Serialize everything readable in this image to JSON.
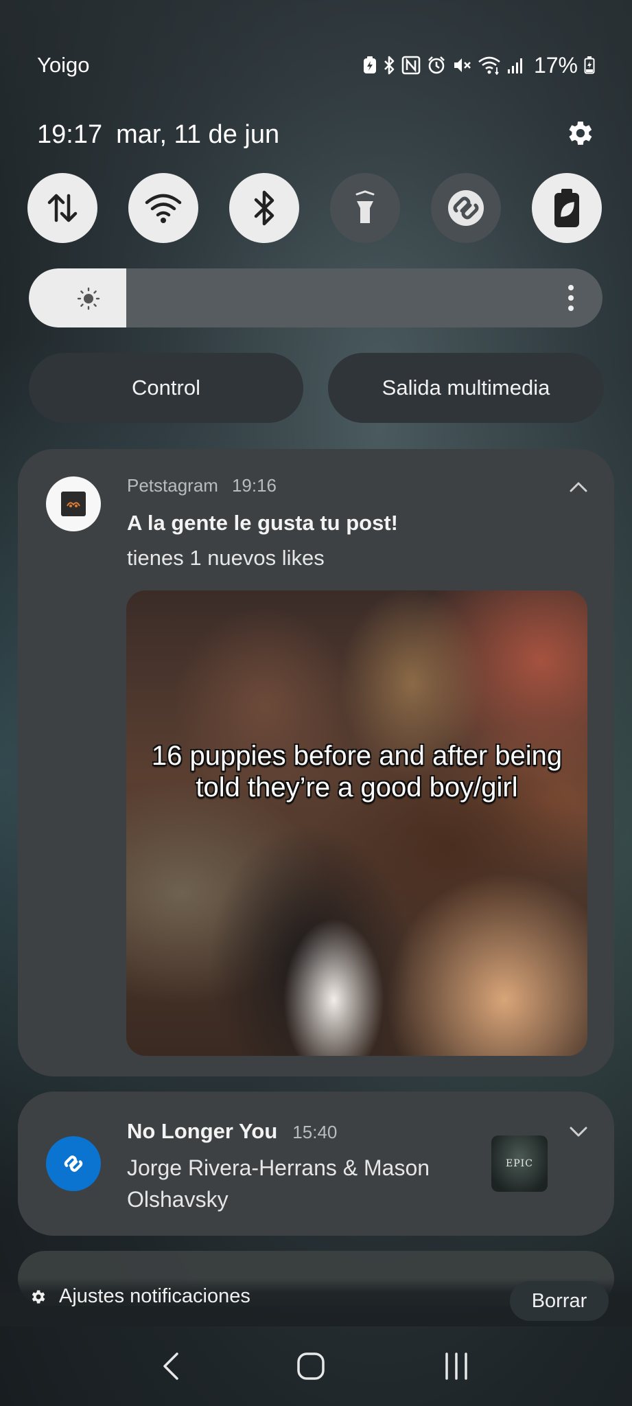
{
  "status_bar": {
    "carrier": "Yoigo",
    "battery_percent": "17%",
    "icons": [
      "battery-saver-icon",
      "bluetooth-icon",
      "nfc-icon",
      "alarm-icon",
      "mute-icon",
      "wifi-icon",
      "signal-icon",
      "battery-charging-icon"
    ]
  },
  "header": {
    "time": "19:17",
    "date": "mar, 11 de jun"
  },
  "quick_tiles": [
    {
      "name": "mobile-data",
      "icon": "data-arrows-icon",
      "active": true
    },
    {
      "name": "wifi",
      "icon": "wifi-icon",
      "active": true
    },
    {
      "name": "bluetooth",
      "icon": "bluetooth-icon",
      "active": true
    },
    {
      "name": "flashlight",
      "icon": "flashlight-icon",
      "active": false
    },
    {
      "name": "shazam",
      "icon": "shazam-icon",
      "active": false
    },
    {
      "name": "power-saving",
      "icon": "eco-battery-icon",
      "active": true
    }
  ],
  "brightness": {
    "level": 0.17
  },
  "buttons": {
    "control": "Control",
    "media_output": "Salida multimedia"
  },
  "notifications": [
    {
      "app": "Petstagram",
      "time": "19:16",
      "title": "A la gente le gusta tu post!",
      "text": "tienes 1 nuevos likes",
      "image_caption": "16 puppies before and after being told they’re a good boy/girl"
    },
    {
      "app": "Shazam",
      "title": "No Longer You",
      "time": "15:40",
      "text": "Jorge Rivera-Herrans & Mason Olshavsky",
      "album_label": "EPIC"
    }
  ],
  "footer": {
    "settings": "Ajustes notificaciones",
    "clear": "Borrar"
  },
  "colors": {
    "tile_on": "#ececec",
    "tile_off": "#4a4f53",
    "card": "#3d4143",
    "shazam_blue": "#0a74d0"
  }
}
